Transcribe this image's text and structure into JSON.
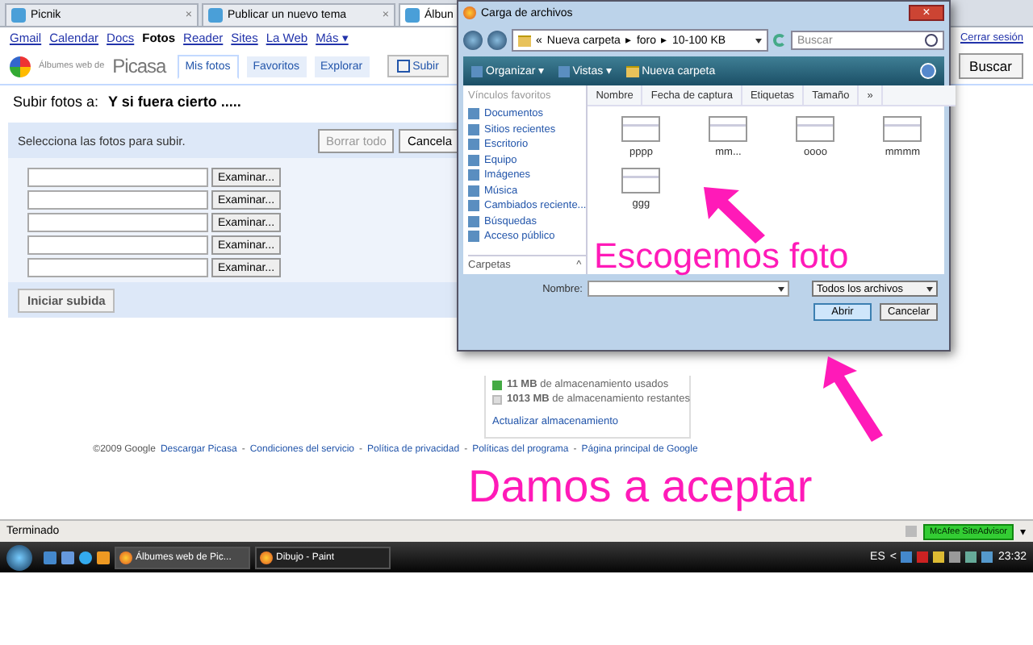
{
  "browser_tabs": [
    {
      "label": "Picnik",
      "selected": false,
      "close": "×"
    },
    {
      "label": "Publicar un nuevo tema",
      "selected": false,
      "close": "×"
    },
    {
      "label": "Álbun",
      "selected": true
    }
  ],
  "google_bar": {
    "links": [
      {
        "label": "Gmail",
        "selected": false
      },
      {
        "label": "Calendar",
        "selected": false
      },
      {
        "label": "Docs",
        "selected": false
      },
      {
        "label": "Fotos",
        "selected": true
      },
      {
        "label": "Reader",
        "selected": false
      },
      {
        "label": "Sites",
        "selected": false
      },
      {
        "label": "La Web",
        "selected": false
      },
      {
        "label": "Más ▾",
        "selected": false
      }
    ],
    "sign_out": "Cerrar sesión"
  },
  "picasa_header": {
    "logo_prefix": "Álbumes web de",
    "logo": "Picasa",
    "tabs": [
      {
        "label": "Mis fotos",
        "selected": true
      },
      {
        "label": "Favoritos",
        "selected": false
      },
      {
        "label": "Explorar",
        "selected": false
      }
    ],
    "upload_button": "Subir",
    "search_button": "Buscar"
  },
  "upload": {
    "title_label": "Subir fotos a:",
    "album": "Y si fuera cierto .....",
    "instruction": "Selecciona las fotos para subir.",
    "clear_button": "Borrar todo",
    "cancel_button": "Cancela",
    "file_rows": [
      {
        "button": "Examinar..."
      },
      {
        "button": "Examinar..."
      },
      {
        "button": "Examinar..."
      },
      {
        "button": "Examinar..."
      },
      {
        "button": "Examinar..."
      }
    ],
    "start_button": "Iniciar subida"
  },
  "storage": {
    "used": "**11 MB** de almacenamiento usados",
    "remaining": "**1013 MB** de almacenamiento restantes",
    "upgrade_link": "Actualizar almacenamiento"
  },
  "footer": {
    "copyright": "©2009 Google",
    "separator": "-",
    "links": [
      "Descargar Picasa",
      "Condiciones del servicio",
      "Política de privacidad",
      "Políticas del programa",
      "Página principal de Google"
    ]
  },
  "dialog": {
    "title": "Carga de archivos",
    "close": "×",
    "breadcrumb": [
      "«",
      "Nueva carpeta",
      "▸",
      "foro",
      "▸",
      "10-100 KB"
    ],
    "search_placeholder": "Buscar",
    "toolbar": [
      "Organizar ▾",
      "Vistas ▾",
      "Nueva carpeta"
    ],
    "favorites_heading": "Vínculos favoritos",
    "favorites": [
      "Documentos",
      "Sitios recientes",
      "Escritorio",
      "Equipo",
      "Imágenes",
      "Música",
      "Cambiados reciente...",
      "Búsquedas",
      "Acceso público"
    ],
    "folders_heading": "Carpetas",
    "folders_toggle": "^",
    "columns": [
      "Nombre",
      "Fecha de captura",
      "Etiquetas",
      "Tamaño",
      "»"
    ],
    "files": [
      "pppp",
      "mm...",
      "oooo",
      "mmmm",
      "ggg"
    ],
    "name_label": "Nombre:",
    "type_filter": "Todos los archivos",
    "open_button": "Abrir",
    "cancel_button": "Cancelar"
  },
  "annotations": [
    {
      "text": "Escogemos foto"
    },
    {
      "text": "Damos a aceptar"
    }
  ],
  "status_bar": {
    "text": "Terminado",
    "advisor": "McAfee SiteAdvisor",
    "menu": "▾"
  },
  "taskbar": {
    "tasks": [
      {
        "label": "Álbumes web de Pic...",
        "selected": true
      },
      {
        "label": "Dibujo - Paint",
        "selected": false
      }
    ],
    "language": "ES",
    "tray_toggle": "<",
    "clock": "23:32"
  }
}
